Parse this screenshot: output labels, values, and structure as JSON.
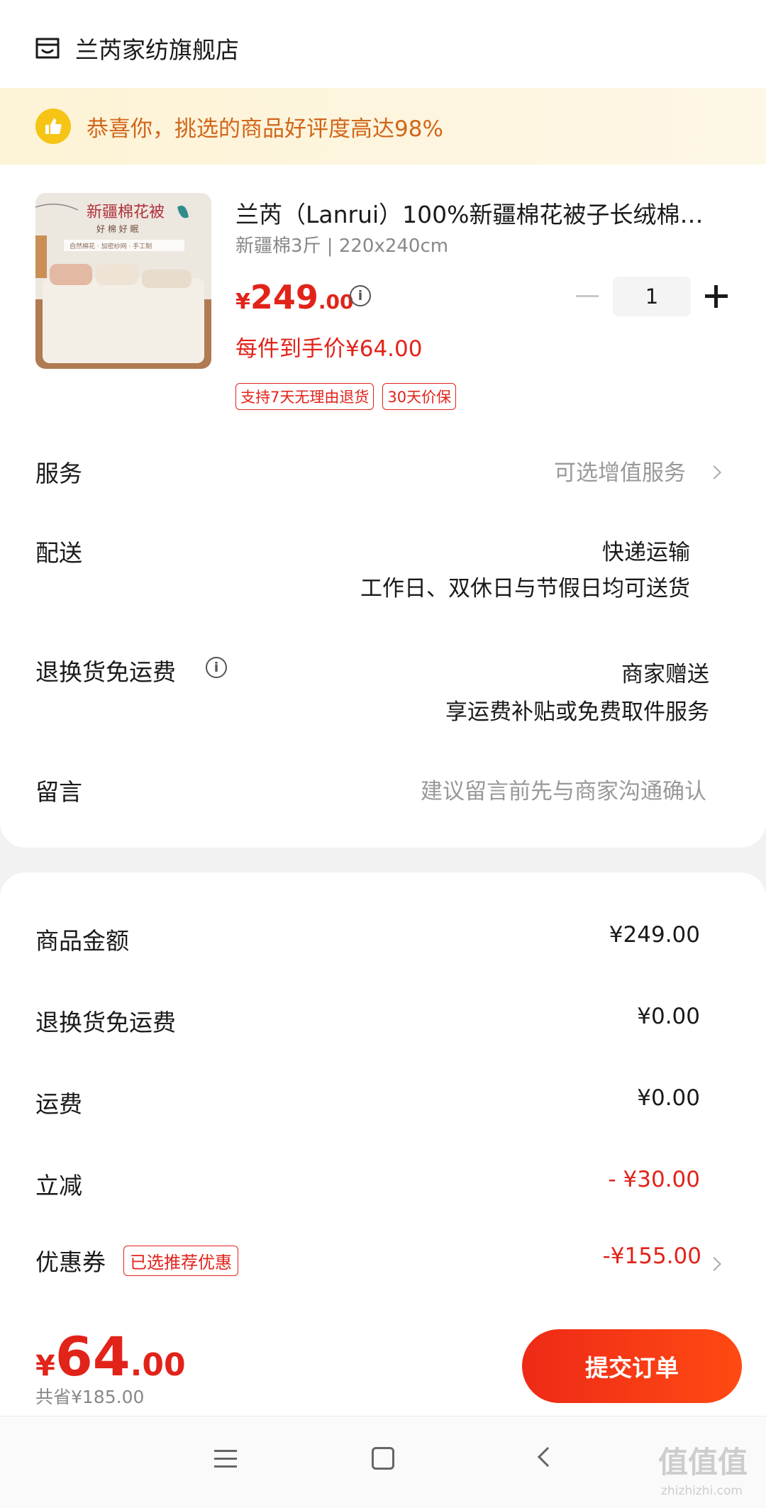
{
  "shop": {
    "name": "兰芮家纺旗舰店"
  },
  "banner": {
    "text": "恭喜你，挑选的商品好评度高达98%"
  },
  "product": {
    "title": "兰芮（Lanrui）100%新疆棉花被子长绒棉…",
    "spec": "新疆棉3斤 | 220x240cm",
    "price_currency": "¥",
    "price_int": "249",
    "price_dec": ".00",
    "unit_price": "每件到手价¥64.00",
    "tags": [
      "支持7天无理由退货",
      "30天价保"
    ],
    "image_title": "新疆棉花被",
    "image_subtitle": "好 棉 好 眠",
    "image_caption": "自然棉花 · 加密纱网 · 手工制"
  },
  "stepper": {
    "quantity": "1"
  },
  "rows": {
    "service": {
      "label": "服务",
      "value": "可选增值服务"
    },
    "delivery": {
      "label": "配送",
      "value1": "快递运输",
      "value2": "工作日、双休日与节假日均可送货"
    },
    "return": {
      "label": "退换货免运费",
      "value1": "商家赠送",
      "value2": "享运费补贴或免费取件服务"
    },
    "message": {
      "label": "留言",
      "placeholder": "建议留言前先与商家沟通确认"
    }
  },
  "summary": {
    "goods": {
      "label": "商品金额",
      "value": "¥249.00"
    },
    "return_fee": {
      "label": "退换货免运费",
      "value": "¥0.00"
    },
    "shipping": {
      "label": "运费",
      "value": "¥0.00"
    },
    "discount": {
      "label": "立减",
      "value": "- ¥30.00"
    },
    "coupon": {
      "label": "优惠券",
      "tag": "已选推荐优惠",
      "value": "-¥155.00"
    }
  },
  "footer": {
    "total_currency": "¥",
    "total_int": "64",
    "total_dec": ".00",
    "saved": "共省¥185.00",
    "submit_label": "提交订单"
  },
  "watermark": {
    "text": "值值值",
    "sub": "zhizhizhi.com"
  },
  "icons": [
    "store-icon",
    "thumbs-up-icon",
    "info-icon",
    "chevron-right-icon",
    "minus-icon",
    "plus-icon",
    "menu-icon",
    "home-icon",
    "back-icon"
  ],
  "colors": {
    "accent_red": "#e2231a",
    "banner_bg": "#fdf3d6",
    "banner_text": "#d2661a",
    "thumb_yellow": "#f5c415"
  }
}
